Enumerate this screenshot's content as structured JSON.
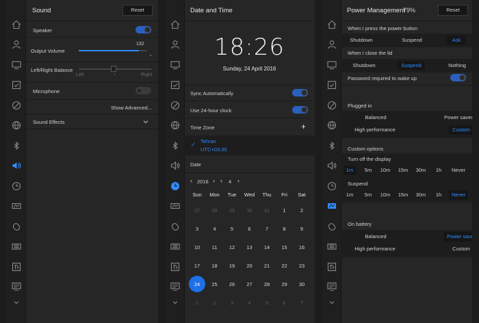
{
  "sound": {
    "title": "Sound",
    "reset": "Reset",
    "speaker": "Speaker",
    "output_volume_label": "Output Volume",
    "output_volume_value": "132",
    "output_volume_fraction": 0.88,
    "balance_label": "Left/Right Balance",
    "balance_left": "Left",
    "balance_right": "Right",
    "microphone": "Microphone",
    "show_advanced": "Show Advanced...",
    "sound_effects": "Sound Effects"
  },
  "datetime": {
    "title": "Date and Time",
    "clock": "18:26",
    "date": "Sunday, 24 April 2016",
    "sync_auto": "Sync Automatically",
    "use_24h": "Use 24-hour clock",
    "timezone_label": "Time Zone",
    "timezone_add": "+",
    "timezone_check": "✓",
    "timezone_city": "Tehran",
    "timezone_offset": "UTC+03:30",
    "date_label": "Date",
    "year": "2016",
    "month": "4",
    "weekdays": [
      "Sun",
      "Mon",
      "Tue",
      "Wed",
      "Thu",
      "Fri",
      "Sat"
    ],
    "weeks": [
      [
        "27",
        "28",
        "29",
        "30",
        "31",
        "1",
        "2"
      ],
      [
        "3",
        "4",
        "5",
        "6",
        "7",
        "8",
        "9"
      ],
      [
        "10",
        "11",
        "12",
        "13",
        "14",
        "15",
        "16"
      ],
      [
        "17",
        "18",
        "19",
        "20",
        "21",
        "22",
        "23"
      ],
      [
        "24",
        "25",
        "26",
        "27",
        "28",
        "29",
        "30"
      ],
      [
        "1",
        "2",
        "3",
        "4",
        "5",
        "6",
        "7"
      ]
    ],
    "selected_day": "24"
  },
  "power": {
    "title": "Power Management",
    "battery": "79%",
    "reset": "Reset",
    "press_power_label": "When I press the power button",
    "press_power_opts": [
      "Shutdown",
      "Suspend",
      "Ask"
    ],
    "close_lid_label": "When I close the lid",
    "close_lid_opts": [
      "Shutdown",
      "Suspend",
      "Nothing"
    ],
    "password_wake": "Password required to wake up",
    "plugged_in_label": "Plugged in",
    "plugged_opts": [
      "Balanced",
      "Power saver",
      "High performance",
      "Custom"
    ],
    "custom_options": "Custom options",
    "turn_off_display": "Turn off the display",
    "display_opts": [
      "1m",
      "5m",
      "10m",
      "15m",
      "30m",
      "1h",
      "Never"
    ],
    "suspend_label": "Suspend",
    "suspend_opts": [
      "1m",
      "5m",
      "10m",
      "15m",
      "30m",
      "1h",
      "Never"
    ],
    "on_battery_label": "On battery",
    "battery_opts": [
      "Balanced",
      "Power saver",
      "High performance",
      "Custom"
    ]
  },
  "accent_color": "#2f8cff"
}
